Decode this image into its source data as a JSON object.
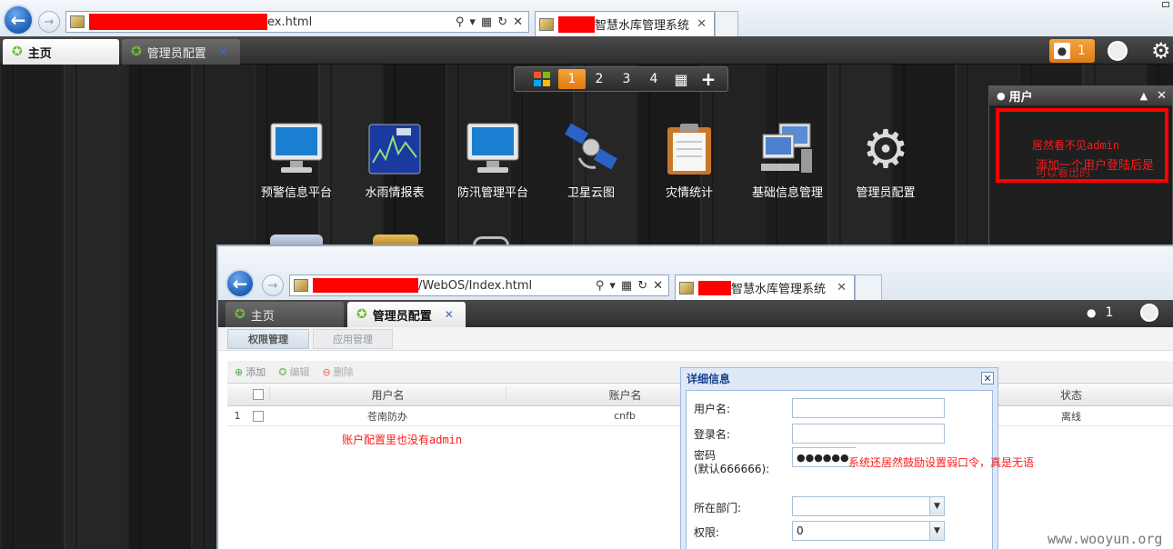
{
  "outer_browser": {
    "address_tail": "ex.html",
    "tab_title": "智慧水库管理系统"
  },
  "webos_tabs": [
    {
      "label": "主页",
      "active": true
    },
    {
      "label": "管理员配置",
      "active": false
    }
  ],
  "top_right": {
    "user_count": "1"
  },
  "dock": {
    "items": [
      "1",
      "2",
      "3",
      "4"
    ]
  },
  "desktop_icons": [
    {
      "label": "预警信息平台",
      "icon": "monitor-icon"
    },
    {
      "label": "水雨情报表",
      "icon": "chart-icon"
    },
    {
      "label": "防汛管理平台",
      "icon": "monitor-icon"
    },
    {
      "label": "卫星云图",
      "icon": "satellite-icon"
    },
    {
      "label": "灾情统计",
      "icon": "clipboard-icon"
    },
    {
      "label": "基础信息管理",
      "icon": "computers-icon"
    },
    {
      "label": "管理员配置",
      "icon": "gear-icon"
    }
  ],
  "user_panel": {
    "title": "用户",
    "annotation_line1": "居然看不见admin",
    "annotation_line2": "添加一个用户登陆后是",
    "annotation_line3": "可以看出的"
  },
  "inner_browser": {
    "address_tail": "/WebOS/Index.html",
    "tab_title": "智慧水库管理系统",
    "webos_tabs": [
      {
        "label": "主页",
        "active": false
      },
      {
        "label": "管理员配置",
        "active": true
      }
    ],
    "user_count": "1",
    "sub_tabs": [
      "权限管理",
      "应用管理"
    ],
    "toolbar": {
      "add": "添加",
      "edit": "编辑",
      "delete": "删除"
    },
    "grid": {
      "columns": [
        "用户名",
        "账户名",
        "状态"
      ],
      "rows": [
        {
          "index": "1",
          "username": "苍南防办",
          "account": "cnfb",
          "status": "离线"
        }
      ]
    },
    "annotation_grid": "账户配置里也没有admin",
    "dialog": {
      "title": "详细信息",
      "fields": {
        "username_label": "用户名:",
        "login_label": "登录名:",
        "password_label_1": "密码",
        "password_label_2": "(默认666666):",
        "password_value": "●●●●●●",
        "dept_label": "所在部门:",
        "perm_label": "权限:",
        "perm_value": "0"
      }
    },
    "annotation_password": "系统还居然鼓励设置弱口令，真是无语"
  },
  "watermark": "www.wooyun.org",
  "colors": {
    "accent_orange": "#f08c1e",
    "annotation_red": "#ff1a1a",
    "ext_blue": "#15428b"
  }
}
